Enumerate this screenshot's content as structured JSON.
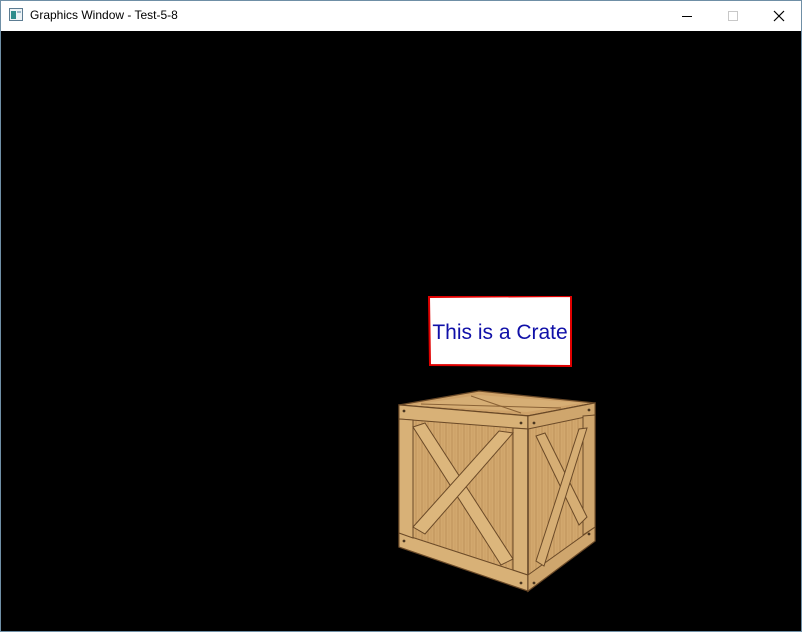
{
  "window": {
    "title": "Graphics Window - Test-5-8",
    "icon": "app-window-icon",
    "controls": [
      "minimize-icon",
      "maximize-icon",
      "close-icon"
    ]
  },
  "scene": {
    "background": "#000000",
    "label": {
      "text": "This is a Crate",
      "text_color": "#1010a8",
      "border_color": "#e00000",
      "fill_color": "#ffffff"
    },
    "crate": {
      "wood_light": "#d9b27a",
      "wood_mid": "#c49a5e",
      "wood_dark": "#7a5530"
    }
  }
}
